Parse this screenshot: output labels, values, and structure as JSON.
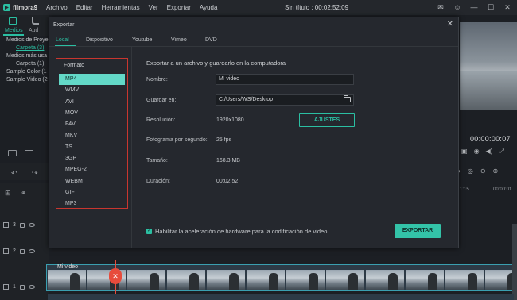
{
  "app": {
    "logo_text": "filmora9",
    "menu": [
      "Archivo",
      "Editar",
      "Herramientas",
      "Ver",
      "Exportar",
      "Ayuda"
    ],
    "window_title": "Sin título : 00:02:52:09"
  },
  "left_panel": {
    "tab_media": "Medios",
    "tab_audio": "Aud",
    "items": [
      {
        "label": "Medios de Proye",
        "level": 1,
        "link": false
      },
      {
        "label": "Carpeta (3)",
        "level": 2,
        "link": true
      },
      {
        "label": "Medios más usa",
        "level": 1,
        "link": false
      },
      {
        "label": "Carpeta (1)",
        "level": 2,
        "link": false
      },
      {
        "label": "Sample Color (1",
        "level": 1,
        "link": false
      },
      {
        "label": "Sample Video (2",
        "level": 1,
        "link": false
      }
    ]
  },
  "preview": {
    "timecode": "00:00:00:07"
  },
  "timeline": {
    "ruler_1": "1:15",
    "ruler_2": "00:00:01",
    "clip_label": "Mi video",
    "tracks": [
      "3",
      "2",
      "1"
    ]
  },
  "dialog": {
    "title": "Exportar",
    "tabs": [
      "Local",
      "Dispositivo",
      "Youtube",
      "Vimeo",
      "DVD"
    ],
    "active_tab": "Local",
    "format_title": "Formato",
    "formats": [
      "MP4",
      "WMV",
      "AVI",
      "MOV",
      "F4V",
      "MKV",
      "TS",
      "3GP",
      "MPEG-2",
      "WEBM",
      "GIF",
      "MP3"
    ],
    "selected_format": "MP4",
    "heading": "Exportar a un archivo y guardarlo en la computadora",
    "name_label": "Nombre:",
    "name_value": "Mi video",
    "save_label": "Guardar en:",
    "save_value": "C:/Users/WS/Desktop",
    "resolution_label": "Resolución:",
    "resolution_value": "1920x1080",
    "settings_button": "AJUSTES",
    "fps_label": "Fotograma por segundo:",
    "fps_value": "25 fps",
    "size_label": "Tamaño:",
    "size_value": "168.3 MB",
    "duration_label": "Duración:",
    "duration_value": "00:02:52",
    "hw_accel_label": "Habilitar la aceleración de hardware para la codificación de video",
    "hw_accel_checked": true,
    "export_button": "EXPORTAR",
    "accent_color": "#2bbfa2",
    "highlight_color": "#c8362f"
  }
}
